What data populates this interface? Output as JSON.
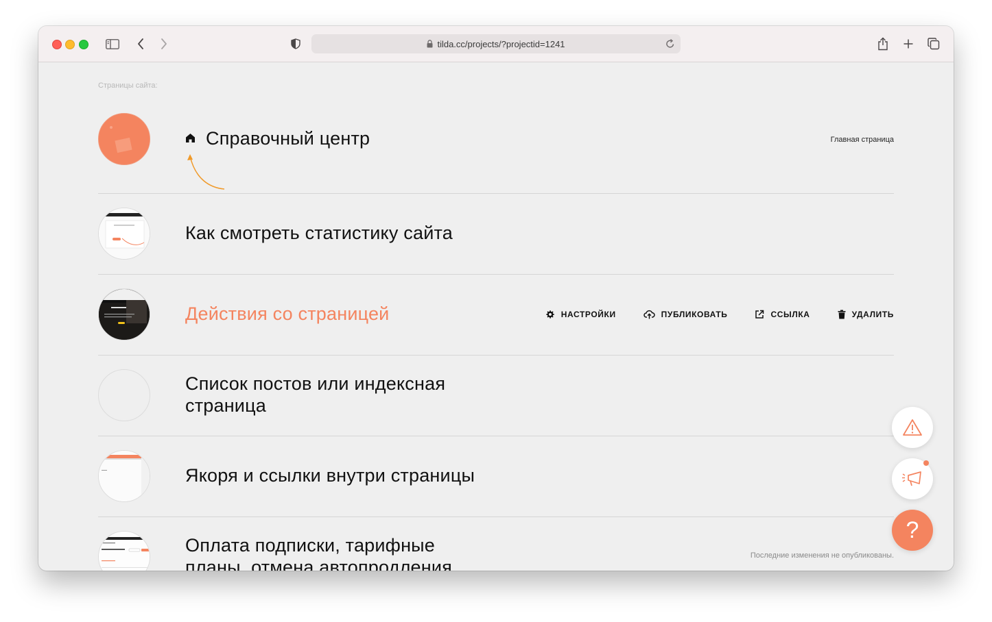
{
  "browser": {
    "url": "tilda.cc/projects/?projectid=1241",
    "icons": [
      "sidebar-icon",
      "back-icon",
      "forward-icon",
      "shield-icon",
      "lock-icon",
      "reload-icon",
      "share-icon",
      "new-tab-icon",
      "tabs-overview-icon"
    ]
  },
  "section_label": "Страницы сайта:",
  "pages": [
    {
      "title": "Справочный центр",
      "tag": "Главная страница",
      "home": true
    },
    {
      "title": "Как смотреть статистику сайта"
    },
    {
      "title": "Действия со страницей",
      "hovered": true
    },
    {
      "title_line1": "Список постов или индексная",
      "title_line2": "страница"
    },
    {
      "title": "Якоря и ссылки внутри страницы"
    },
    {
      "title_line1": "Оплата подписки, тарифные",
      "title_line2": "планы, отмена автопродления",
      "note": "Последние изменения не опубликованы."
    }
  ],
  "actions": {
    "settings": "НАСТРОЙКИ",
    "publish": "ПУБЛИКОВАТЬ",
    "link": "ССЫЛКА",
    "delete": "УДАЛИТЬ"
  },
  "floating_buttons": {
    "help_label": "?",
    "icons": [
      "warning-icon",
      "megaphone-icon"
    ]
  },
  "colors": {
    "accent": "#f4845f",
    "background": "#efefef",
    "text": "#111111"
  }
}
